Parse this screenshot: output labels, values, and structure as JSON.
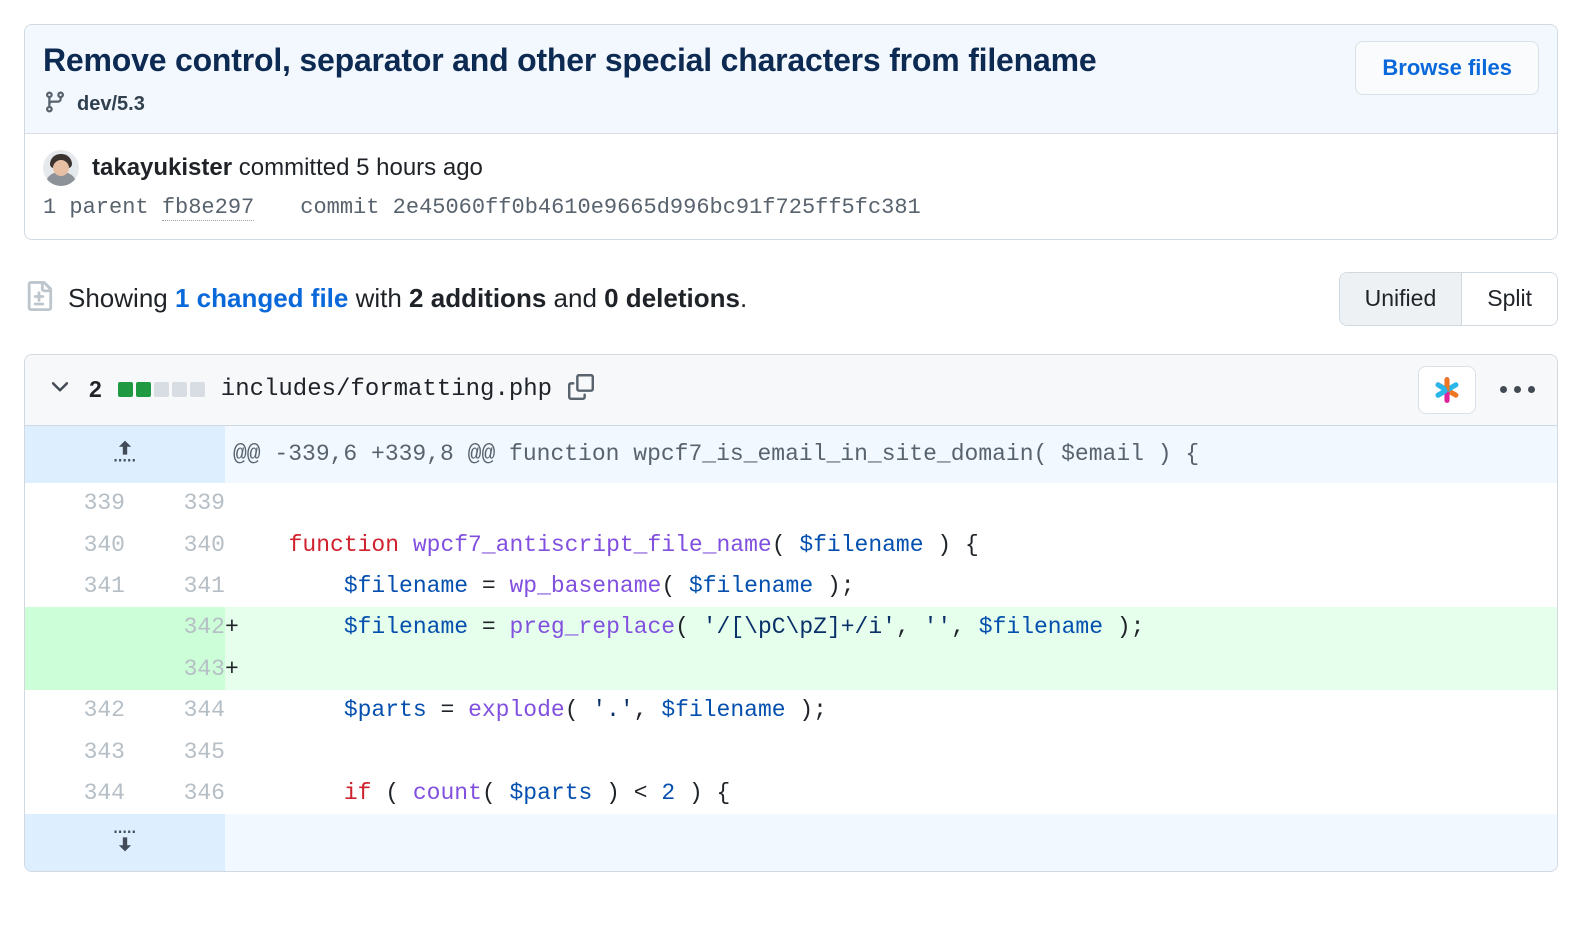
{
  "commit": {
    "title": "Remove control, separator and other special characters from filename",
    "branch": "dev/5.3",
    "branch_icon": "git-branch-icon",
    "browse_files_label": "Browse files",
    "author": "takayukister",
    "committed_text": " committed 5 hours ago",
    "parent_count_label": "1 parent ",
    "parent_sha": "fb8e297",
    "commit_label": "commit ",
    "commit_sha": "2e45060ff0b4610e9665d996bc91f725ff5fc381"
  },
  "summary": {
    "icon": "file-diff-icon",
    "prefix": "Showing ",
    "changed_files": "1 changed file",
    "middle": " with ",
    "additions": "2 additions",
    "conjunction": " and ",
    "deletions": "0 deletions",
    "suffix": ".",
    "view_modes": [
      {
        "label": "Unified",
        "active": true
      },
      {
        "label": "Split",
        "active": false
      }
    ]
  },
  "file": {
    "chevron_icon": "chevron-down-icon",
    "change_count": "2",
    "stat_blocks": [
      "add",
      "add",
      "non",
      "non",
      "non"
    ],
    "filename": "includes/formatting.php",
    "copy_icon": "copy-path-icon",
    "copilot_icon": "copilot-sparkle-icon",
    "kebab_icon": "more-options-icon"
  },
  "diff": {
    "hunk_header": "@@ -339,6 +339,8 @@ function wpcf7_is_email_in_site_domain( $email ) {",
    "expand_up_icon": "expand-up-icon",
    "expand_down_icon": "expand-down-icon",
    "rows": [
      {
        "type": "ctx",
        "old": "339",
        "new": "339",
        "sign": "",
        "tokens": []
      },
      {
        "type": "ctx",
        "old": "340",
        "new": "340",
        "sign": "",
        "tokens": [
          {
            "t": "  ",
            "c": "p"
          },
          {
            "t": "function",
            "c": "k"
          },
          {
            "t": " ",
            "c": "p"
          },
          {
            "t": "wpcf7_antiscript_file_name",
            "c": "fn"
          },
          {
            "t": "( ",
            "c": "p"
          },
          {
            "t": "$filename",
            "c": "v"
          },
          {
            "t": " ) {",
            "c": "p"
          }
        ]
      },
      {
        "type": "ctx",
        "old": "341",
        "new": "341",
        "sign": "",
        "tokens": [
          {
            "t": "      ",
            "c": "p"
          },
          {
            "t": "$filename",
            "c": "v"
          },
          {
            "t": " = ",
            "c": "p"
          },
          {
            "t": "wp_basename",
            "c": "fn"
          },
          {
            "t": "( ",
            "c": "p"
          },
          {
            "t": "$filename",
            "c": "v"
          },
          {
            "t": " );",
            "c": "p"
          }
        ]
      },
      {
        "type": "add",
        "old": "",
        "new": "342",
        "sign": "+",
        "tokens": [
          {
            "t": "      ",
            "c": "p"
          },
          {
            "t": "$filename",
            "c": "v"
          },
          {
            "t": " = ",
            "c": "p"
          },
          {
            "t": "preg_replace",
            "c": "fn"
          },
          {
            "t": "( ",
            "c": "p"
          },
          {
            "t": "'/[\\pC\\pZ]+/i'",
            "c": "s"
          },
          {
            "t": ", ",
            "c": "p"
          },
          {
            "t": "''",
            "c": "s"
          },
          {
            "t": ", ",
            "c": "p"
          },
          {
            "t": "$filename",
            "c": "v"
          },
          {
            "t": " );",
            "c": "p"
          }
        ]
      },
      {
        "type": "add",
        "old": "",
        "new": "343",
        "sign": "+",
        "tokens": []
      },
      {
        "type": "ctx",
        "old": "342",
        "new": "344",
        "sign": "",
        "tokens": [
          {
            "t": "      ",
            "c": "p"
          },
          {
            "t": "$parts",
            "c": "v"
          },
          {
            "t": " = ",
            "c": "p"
          },
          {
            "t": "explode",
            "c": "fn"
          },
          {
            "t": "( ",
            "c": "p"
          },
          {
            "t": "'.'",
            "c": "s"
          },
          {
            "t": ", ",
            "c": "p"
          },
          {
            "t": "$filename",
            "c": "v"
          },
          {
            "t": " );",
            "c": "p"
          }
        ]
      },
      {
        "type": "ctx",
        "old": "343",
        "new": "345",
        "sign": "",
        "tokens": []
      },
      {
        "type": "ctx",
        "old": "344",
        "new": "346",
        "sign": "",
        "tokens": [
          {
            "t": "      ",
            "c": "p"
          },
          {
            "t": "if",
            "c": "k"
          },
          {
            "t": " ( ",
            "c": "p"
          },
          {
            "t": "count",
            "c": "fn"
          },
          {
            "t": "( ",
            "c": "p"
          },
          {
            "t": "$parts",
            "c": "v"
          },
          {
            "t": " ) < ",
            "c": "p"
          },
          {
            "t": "2",
            "c": "n"
          },
          {
            "t": " ) {",
            "c": "p"
          }
        ]
      }
    ]
  }
}
